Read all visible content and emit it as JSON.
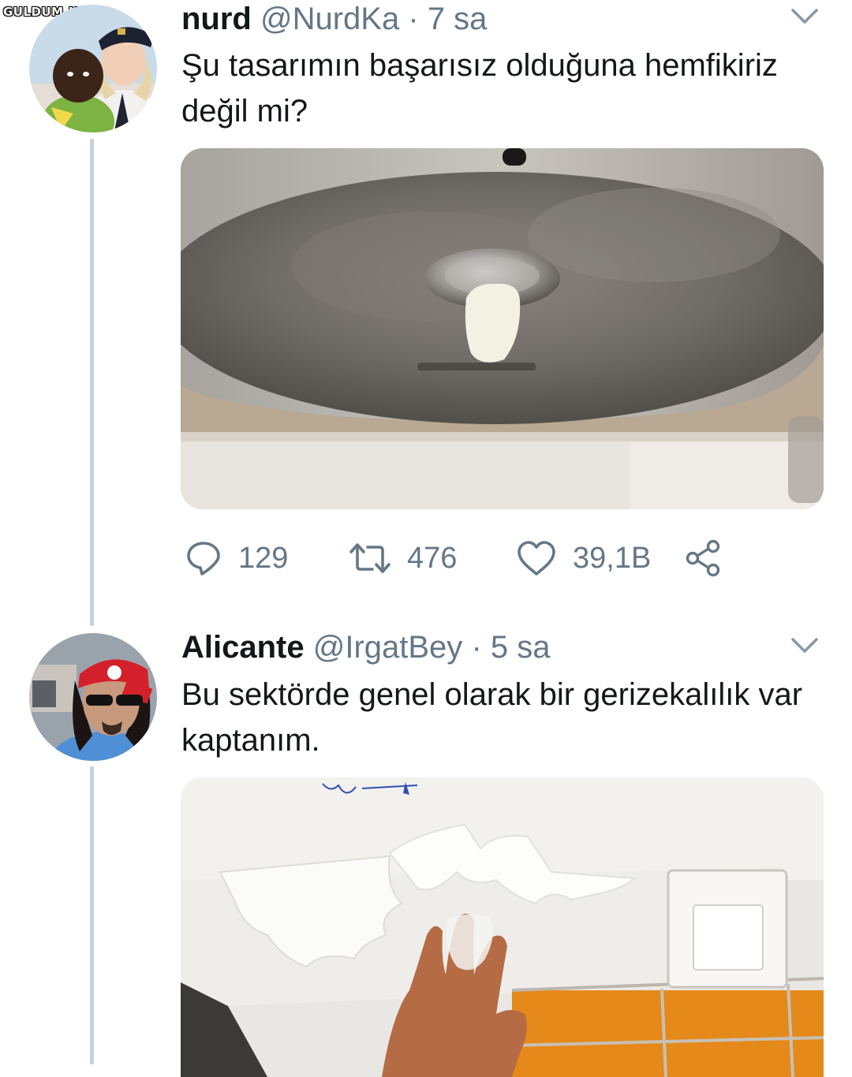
{
  "watermark": "GULDUM.NET",
  "tweets": [
    {
      "name": "nurd",
      "handle": "@NurdKa",
      "separator": "·",
      "time": "7 sa",
      "text": "Şu tasarımın başarısız olduğuna hemfikiriz değil mi?",
      "media": {
        "description": "stainless-sink-dispenser-photo"
      },
      "actions": {
        "replies": "129",
        "retweets": "476",
        "likes": "39,1B"
      }
    },
    {
      "name": "Alicante",
      "handle": "@IrgatBey",
      "separator": "·",
      "time": "5 sa",
      "text": "Bu sektörde genel olarak bir gerizekalılık var kaptanım.",
      "media": {
        "description": "paper-towel-dispenser-photo"
      }
    }
  ],
  "icons": {
    "reply": "speech-bubble-icon",
    "retweet": "retweet-arrows-icon",
    "like": "heart-icon",
    "share": "share-icon",
    "menu": "chevron-down-icon"
  },
  "colors": {
    "text": "#14171a",
    "muted": "#657786",
    "thread": "#c5d2df"
  }
}
